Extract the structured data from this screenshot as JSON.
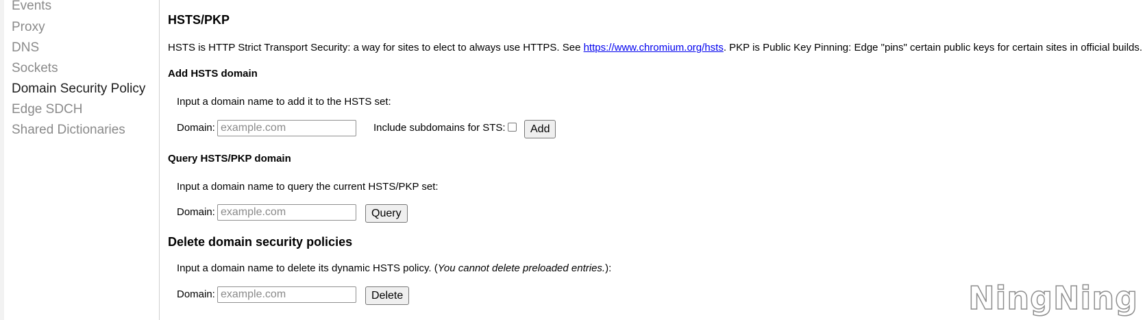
{
  "sidebar": {
    "items": [
      {
        "label": "Events"
      },
      {
        "label": "Proxy"
      },
      {
        "label": "DNS"
      },
      {
        "label": "Sockets"
      },
      {
        "label": "Domain Security Policy",
        "active": true
      },
      {
        "label": "Edge SDCH"
      },
      {
        "label": "Shared Dictionaries"
      }
    ]
  },
  "main": {
    "title": "HSTS/PKP",
    "intro": {
      "before_link": "HSTS is HTTP Strict Transport Security: a way for sites to elect to always use HTTPS. See ",
      "link_text": "https://www.chromium.org/hsts",
      "after_link": ". PKP is Public Key Pinning: Edge \"pins\" certain public keys for certain sites in official builds."
    },
    "add": {
      "heading": "Add HSTS domain",
      "instruction": "Input a domain name to add it to the HSTS set:",
      "domain_label": "Domain:",
      "placeholder": "example.com",
      "subdomains_label": "Include subdomains for STS:",
      "subdomains_checked": false,
      "button_label": "Add"
    },
    "query": {
      "heading": "Query HSTS/PKP domain",
      "instruction": "Input a domain name to query the current HSTS/PKP set:",
      "domain_label": "Domain:",
      "placeholder": "example.com",
      "button_label": "Query"
    },
    "delete": {
      "heading": "Delete domain security policies",
      "instruction_before": "Input a domain name to delete its dynamic HSTS policy. (",
      "instruction_italic": "You cannot delete preloaded entries.",
      "instruction_after": "):",
      "domain_label": "Domain:",
      "placeholder": "example.com",
      "button_label": "Delete"
    }
  },
  "watermark": "NingNing"
}
